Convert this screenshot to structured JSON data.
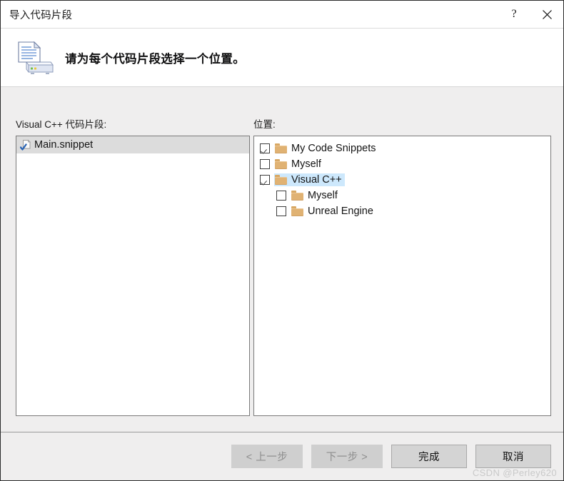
{
  "window": {
    "title": "导入代码片段",
    "help_label": "?",
    "close_label": "✕",
    "help_icon": "question-mark-icon",
    "close_icon": "close-icon"
  },
  "header": {
    "title": "请为每个代码片段选择一个位置。",
    "icon": "document-scanner-import-icon"
  },
  "left_panel": {
    "label": "Visual C++ 代码片段:",
    "items": [
      {
        "name": "Main.snippet",
        "icon": "snippet-file-icon",
        "selected": true
      }
    ]
  },
  "right_panel": {
    "label": "位置:",
    "tree": [
      {
        "label": "My Code Snippets",
        "icon": "folder-icon",
        "checked": true,
        "selected": false,
        "level": 0
      },
      {
        "label": "Myself",
        "icon": "folder-icon",
        "checked": false,
        "selected": false,
        "level": 0
      },
      {
        "label": "Visual C++",
        "icon": "folder-icon",
        "checked": true,
        "selected": true,
        "level": 0
      },
      {
        "label": "Myself",
        "icon": "folder-icon",
        "checked": false,
        "selected": false,
        "level": 1
      },
      {
        "label": "Unreal Engine",
        "icon": "folder-icon",
        "checked": false,
        "selected": false,
        "level": 1
      }
    ]
  },
  "footer": {
    "buttons": [
      {
        "label": "< 上一步",
        "state": "disabled"
      },
      {
        "label": "下一步 >",
        "state": "disabled"
      },
      {
        "label": "完成",
        "state": "enabled"
      },
      {
        "label": "取消",
        "state": "enabled"
      }
    ]
  },
  "watermark": "CSDN @Perley620",
  "colors": {
    "dialog_bg": "#efeeee",
    "header_bg": "#ffffff",
    "selection_blue": "#cde8fc",
    "selection_gray": "#dcdcdc",
    "folder_tan": "#e0b273",
    "border_dark": "#2b2b2b",
    "disabled_text": "#8e8e8e"
  }
}
